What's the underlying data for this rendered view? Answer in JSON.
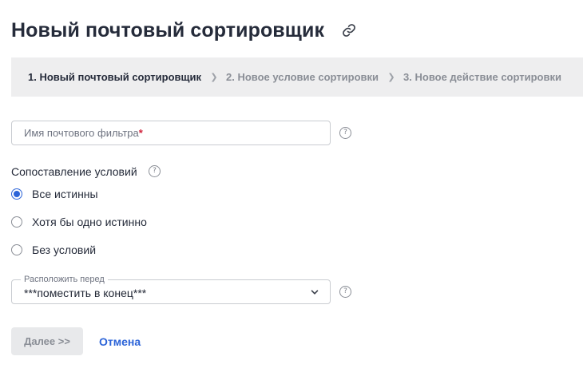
{
  "header": {
    "title": "Новый почтовый сортировщик",
    "link_icon": "link-icon"
  },
  "steps": [
    {
      "label": "1. Новый почтовый сортировщик",
      "active": true
    },
    {
      "label": "2. Новое условие сортировки",
      "active": false
    },
    {
      "label": "3. Новое действие сортировки",
      "active": false
    }
  ],
  "filter_name": {
    "placeholder": "Имя почтового фильтра",
    "required_mark": "*",
    "value": ""
  },
  "match": {
    "label": "Сопоставление условий",
    "options": [
      {
        "label": "Все истинны",
        "checked": true
      },
      {
        "label": "Хотя бы одно истинно",
        "checked": false
      },
      {
        "label": "Без условий",
        "checked": false
      }
    ]
  },
  "position": {
    "legend": "Расположить перед",
    "value": "***поместить в конец***"
  },
  "buttons": {
    "next": "Далее >>",
    "cancel": "Отмена"
  },
  "colors": {
    "accent": "#2c64d8",
    "required": "#d0213a",
    "steps_background": "#eeeeef"
  }
}
